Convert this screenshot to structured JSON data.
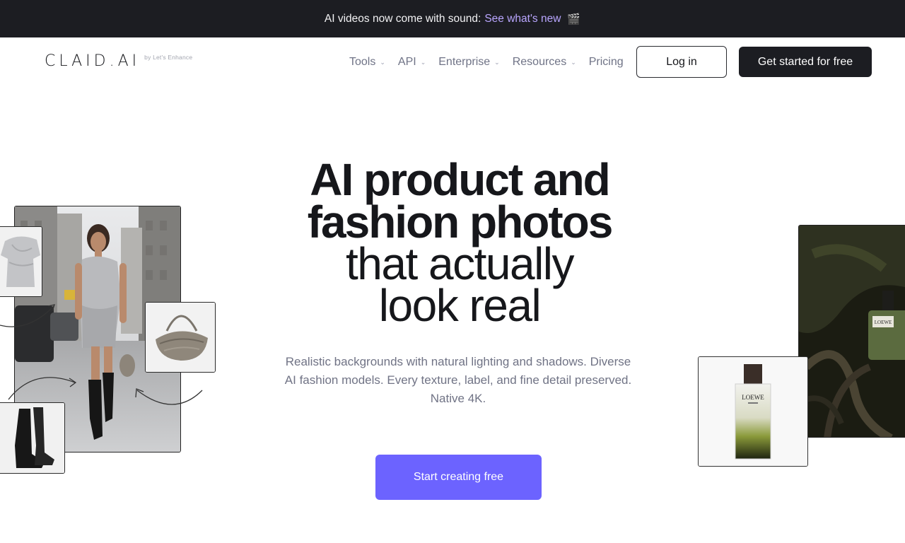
{
  "announcement": {
    "text": "AI videos now come with sound:",
    "link": "See what's new",
    "emoji": "🎬"
  },
  "brand": {
    "logo": "CLAID.AI",
    "byline": "by Let's Enhance"
  },
  "nav": {
    "items": [
      {
        "label": "Tools",
        "has_dropdown": true
      },
      {
        "label": "API",
        "has_dropdown": true
      },
      {
        "label": "Enterprise",
        "has_dropdown": true
      },
      {
        "label": "Resources",
        "has_dropdown": true
      },
      {
        "label": "Pricing",
        "has_dropdown": false
      }
    ],
    "login": "Log in",
    "get_started": "Get started for free"
  },
  "hero": {
    "title_bold_1": "AI product and",
    "title_bold_2": "fashion photos",
    "title_light_1": "that actually",
    "title_light_2": "look real",
    "subtitle": "Realistic backgrounds with natural lighting and shadows. Diverse AI fashion models. Every texture, label, and fine detail preserved. Native 4K.",
    "cta": "Start creating free"
  },
  "images": {
    "bottle_label": "LOEWE",
    "forest_bottle_label": "LOEWE"
  },
  "colors": {
    "accent": "#6c63ff",
    "dark": "#1c1d22",
    "link": "#b9a6ff",
    "muted": "#707385"
  },
  "icons": [
    "chevron-down-icon",
    "clapperboard-icon",
    "curved-arrow-icon"
  ]
}
